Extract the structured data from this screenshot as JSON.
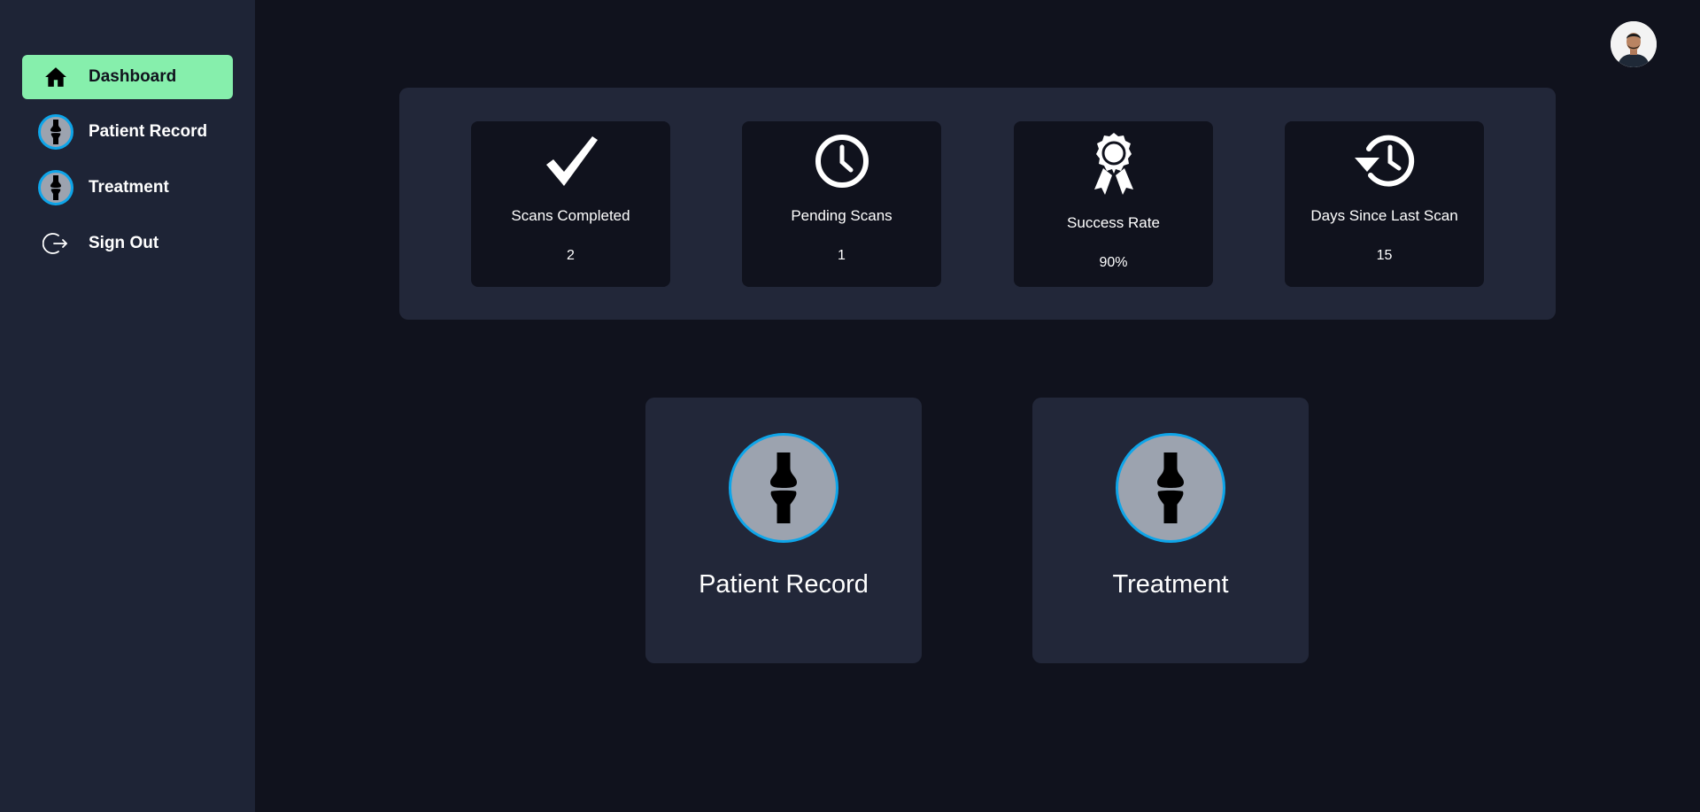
{
  "sidebar": {
    "items": [
      {
        "label": "Dashboard",
        "icon": "home-icon",
        "active": true
      },
      {
        "label": "Patient Record",
        "icon": "knee-joint-icon",
        "active": false
      },
      {
        "label": "Treatment",
        "icon": "knee-joint-icon",
        "active": false
      },
      {
        "label": "Sign Out",
        "icon": "sign-out-icon",
        "active": false
      }
    ]
  },
  "header": {
    "avatar": "user-avatar"
  },
  "stats": [
    {
      "label": "Scans Completed",
      "value": "2",
      "icon": "checkmark-icon"
    },
    {
      "label": "Pending Scans",
      "value": "1",
      "icon": "clock-icon"
    },
    {
      "label": "Success Rate",
      "value": "90%",
      "icon": "award-ribbon-icon"
    },
    {
      "label": "Days Since Last Scan",
      "value": "15",
      "icon": "history-icon"
    }
  ],
  "actions": [
    {
      "label": "Patient Record",
      "icon": "knee-joint-icon"
    },
    {
      "label": "Treatment",
      "icon": "knee-joint-icon"
    }
  ],
  "colors": {
    "background": "#10121d",
    "sidebar": "#1e2436",
    "panel": "#222739",
    "active_nav": "#86efac",
    "accent_ring": "#0ea5e9",
    "icon_circle": "#9ca3af"
  }
}
